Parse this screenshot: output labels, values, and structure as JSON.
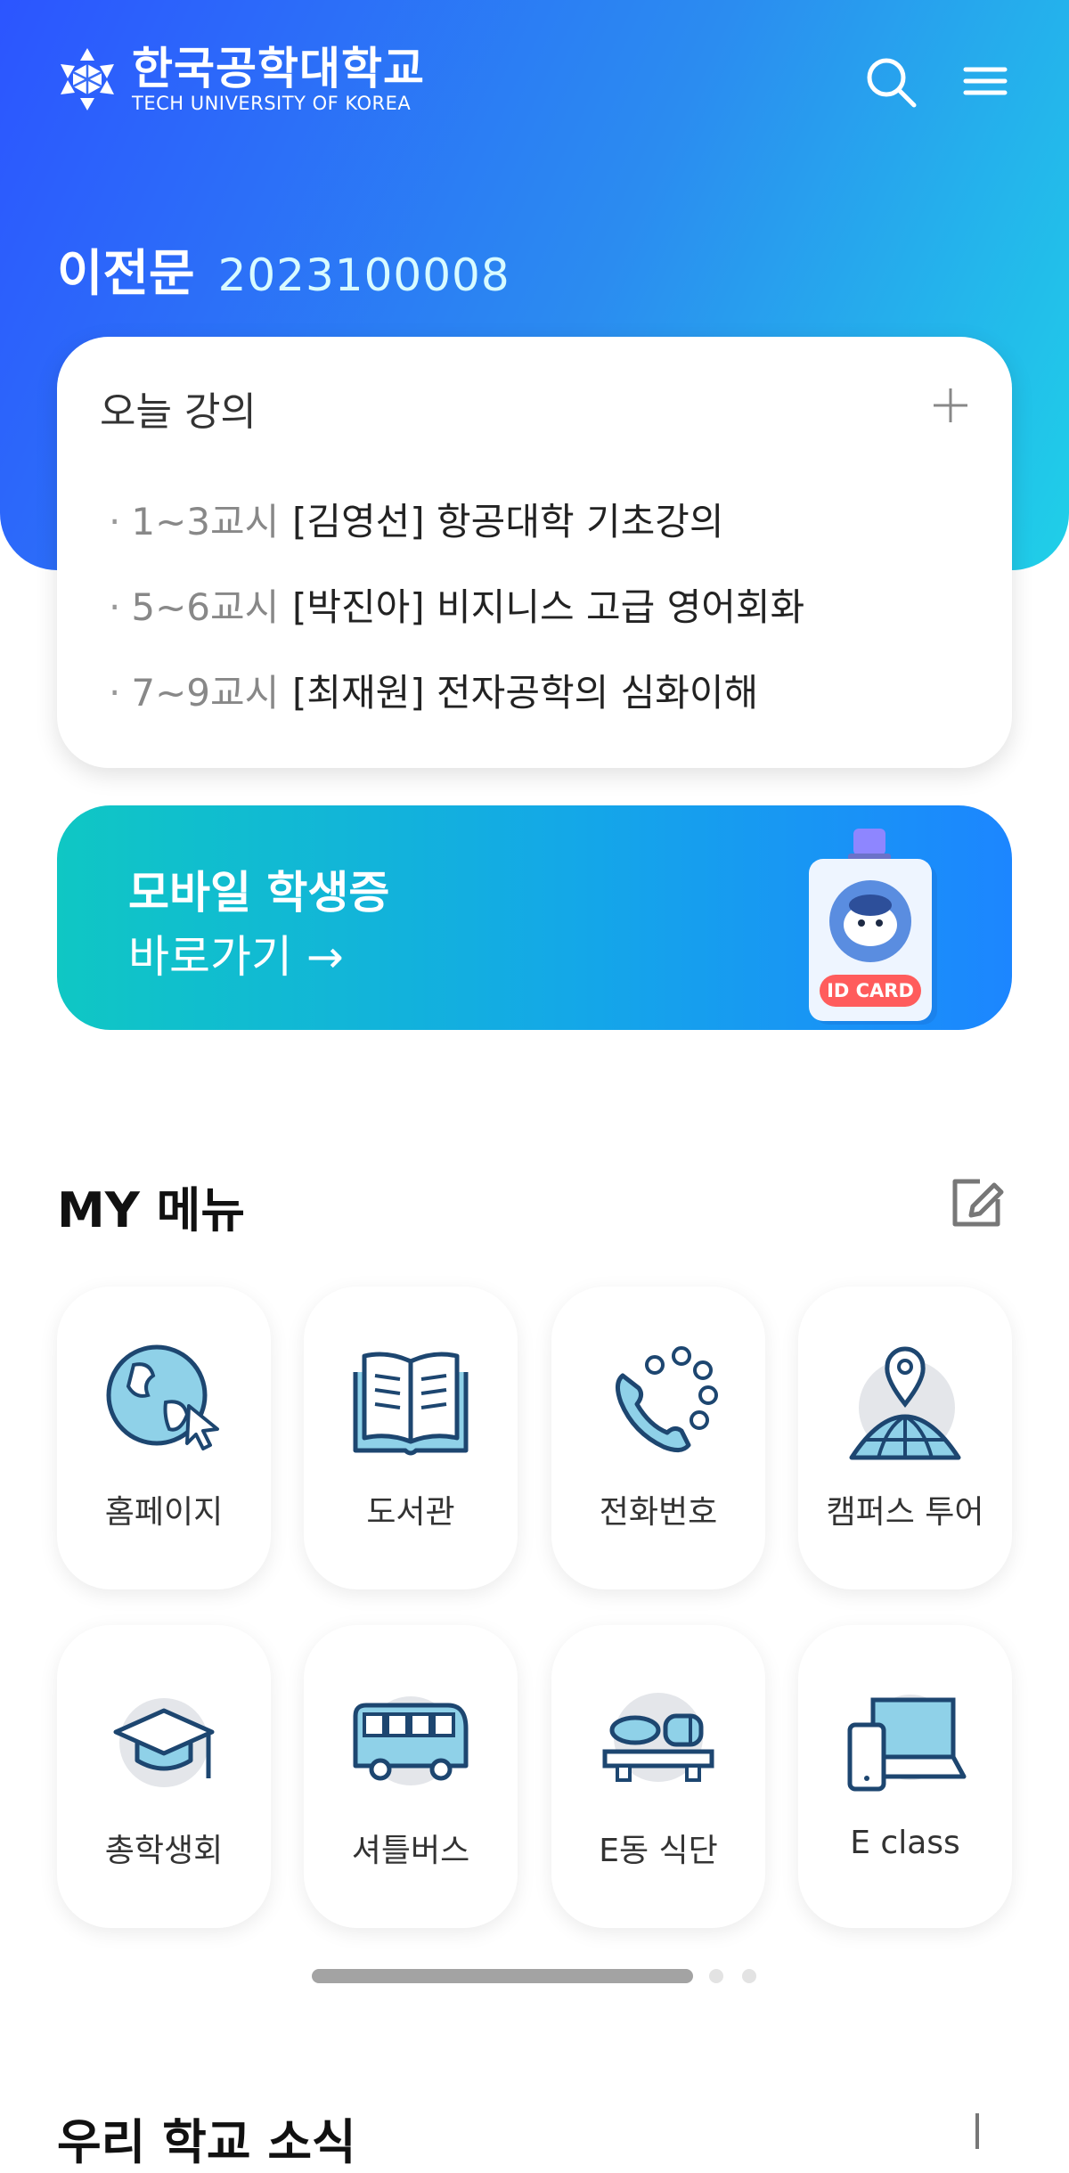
{
  "header": {
    "logo_ko": "한국공학대학교",
    "logo_en": "TECH UNIVERSITY OF KOREA",
    "search_icon": "search-icon",
    "menu_icon": "hamburger-menu-icon"
  },
  "user": {
    "name": "이전문",
    "student_id": "2023100008"
  },
  "today_lectures": {
    "title": "오늘 강의",
    "add_icon": "plus-icon",
    "items": [
      {
        "period": "1~3교시",
        "name": "[김영선] 항공대학 기초강의"
      },
      {
        "period": "5~6교시",
        "name": "[박진아] 비지니스 고급 영어회화"
      },
      {
        "period": "7~9교시",
        "name": "[최재원] 전자공학의 심화이해"
      }
    ]
  },
  "id_banner": {
    "title": "모바일 학생증",
    "link": "바로가기 →",
    "card_label": "ID CARD"
  },
  "my_menu": {
    "title": "MY 메뉴",
    "edit_icon": "edit-icon",
    "items": [
      {
        "label": "홈페이지",
        "icon": "globe-cursor-icon"
      },
      {
        "label": "도서관",
        "icon": "book-icon"
      },
      {
        "label": "전화번호",
        "icon": "phone-icon"
      },
      {
        "label": "캠퍼스 투어",
        "icon": "location-globe-icon"
      },
      {
        "label": "총학생회",
        "icon": "graduation-cap-icon"
      },
      {
        "label": "셔틀버스",
        "icon": "bus-icon"
      },
      {
        "label": "E동 식단",
        "icon": "food-tray-icon"
      },
      {
        "label": "E class",
        "icon": "devices-icon"
      }
    ]
  },
  "pager": {
    "current": 1,
    "total": 3
  },
  "news": {
    "title": "우리 학교 소식",
    "more_icon": "plus-icon"
  },
  "colors": {
    "hero_start": "#2c55ff",
    "hero_end": "#1fd0e8",
    "banner_start": "#0fc7c4",
    "banner_end": "#1c86ff",
    "icon_stroke": "#1d4670",
    "icon_fill": "#8fd1e8"
  }
}
